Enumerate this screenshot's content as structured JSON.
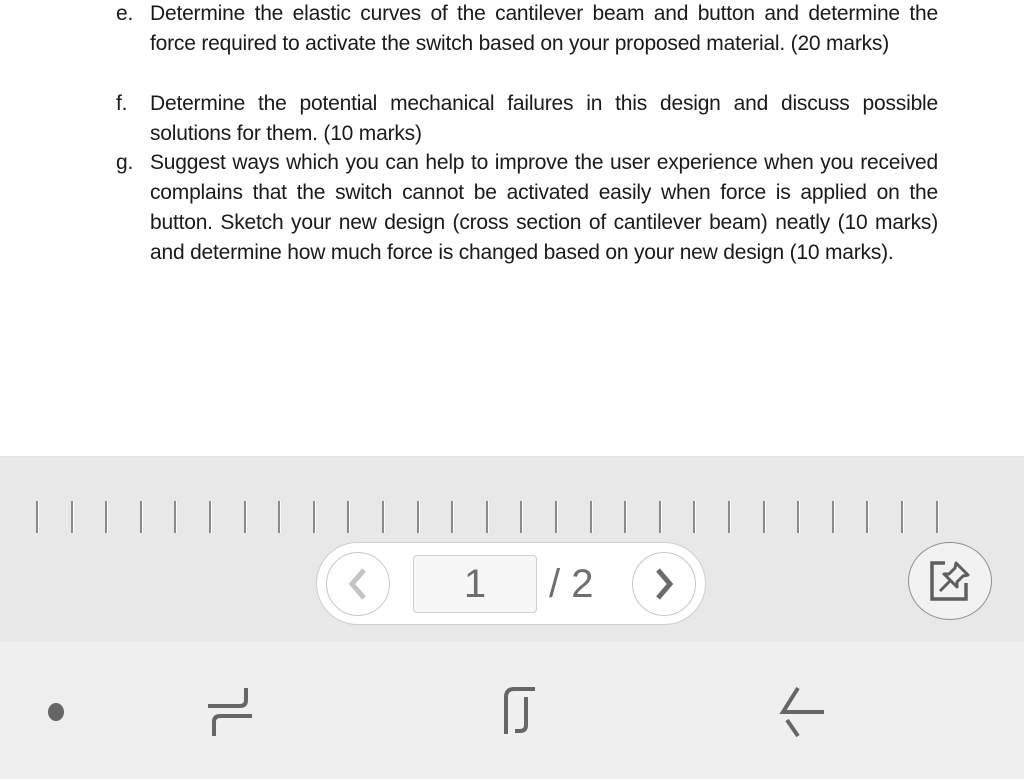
{
  "document": {
    "questions": [
      {
        "letter": "e.",
        "text": "Determine the elastic curves of the cantilever beam and button and determine the force required to activate the switch based on your proposed material. (20 marks)"
      },
      {
        "letter": "f.",
        "text": "Determine the potential mechanical failures in this design and discuss possible solutions for them. (10 marks)"
      },
      {
        "letter": "g.",
        "text": "Suggest ways which you can help to improve the user experience when you received complains that the switch cannot be activated easily when force is applied on the button. Sketch your new design (cross section of cantilever beam) neatly (10 marks) and determine how much force is changed based on your new design (10 marks)."
      }
    ]
  },
  "toolbar": {
    "scrubber_tick_count": 27,
    "pager": {
      "prev_icon": "chevron-left-icon",
      "current_page": "1",
      "total_label": "/ 2",
      "next_icon": "chevron-right-icon"
    },
    "pin_icon": "pin-to-screen-icon"
  },
  "navbar": {
    "items": [
      {
        "name": "nav-dot",
        "icon": "dot-icon"
      },
      {
        "name": "recents",
        "icon": "recents-icon"
      },
      {
        "name": "home",
        "icon": "home-icon"
      },
      {
        "name": "back",
        "icon": "back-arrow-icon"
      }
    ]
  },
  "colors": {
    "toolbar_bg": "#e8e8e8",
    "navbar_bg": "#efefef",
    "icon_gray": "#666666",
    "disabled_gray": "#c4c4c4",
    "text": "#1a1a1a"
  }
}
